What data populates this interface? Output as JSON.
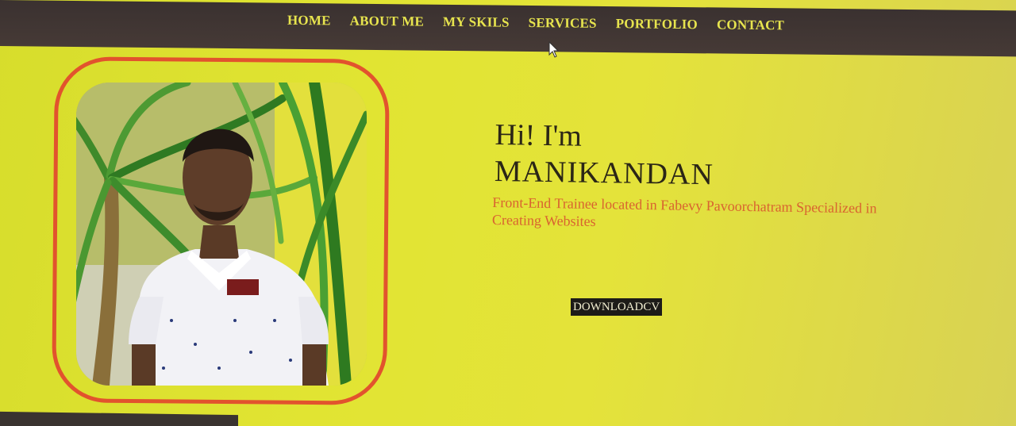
{
  "nav": {
    "items": [
      "HOME",
      "ABOUT ME",
      "MY SKILS",
      "SERVICES",
      "PORTFOLIO",
      "CONTACT"
    ]
  },
  "hero": {
    "greeting": "Hi! I'm",
    "name": "MANIKANDAN",
    "tagline": "Front-End Trainee located in Fabevy Pavoorchatram Specialized in Creating Websites",
    "cta_label": "DOWNLOADCV"
  },
  "colors": {
    "page_background": "#e1e432",
    "nav_background": "#3a3130",
    "nav_text": "#e7e44e",
    "frame_border": "#e2532d",
    "tagline": "#d96330",
    "button_background": "#1d1b18"
  },
  "icons": {
    "cursor": "mouse-pointer-icon"
  }
}
